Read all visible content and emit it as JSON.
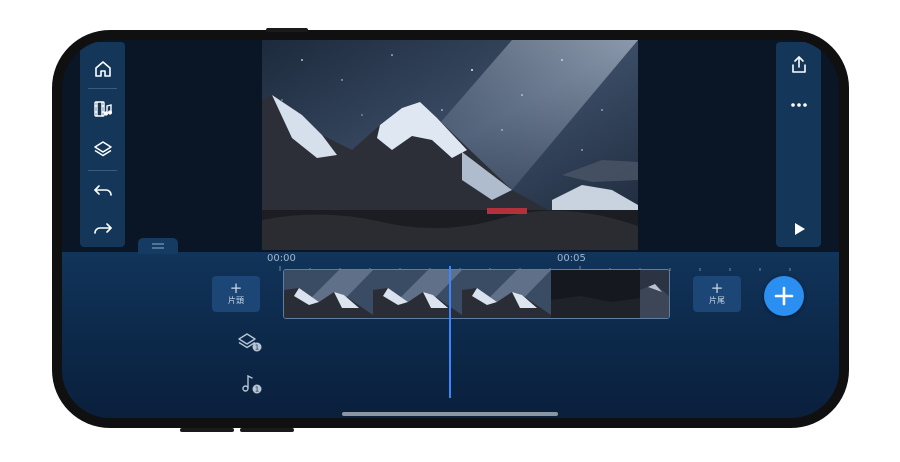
{
  "left_toolbar": {
    "items": [
      {
        "name": "home",
        "icon": "home-icon"
      },
      {
        "name": "media",
        "icon": "film-music-icon"
      },
      {
        "name": "layers",
        "icon": "layers-icon"
      },
      {
        "name": "undo",
        "icon": "undo-icon"
      },
      {
        "name": "redo",
        "icon": "redo-icon"
      }
    ]
  },
  "right_toolbar": {
    "items": [
      {
        "name": "export",
        "icon": "share-icon"
      },
      {
        "name": "more",
        "icon": "more-icon"
      },
      {
        "name": "play",
        "icon": "play-icon"
      }
    ]
  },
  "timeline": {
    "time_start": "00:00",
    "time_mid": "00:05",
    "add_intro": {
      "plus": "+",
      "label": "片頭"
    },
    "add_outro": {
      "plus": "+",
      "label": "片尾"
    },
    "layer_track_count": "1",
    "audio_track_count": "1"
  },
  "colors": {
    "accent": "#2a8ff0",
    "playhead": "#3a86ff",
    "toolbar_bg": "#133659"
  }
}
